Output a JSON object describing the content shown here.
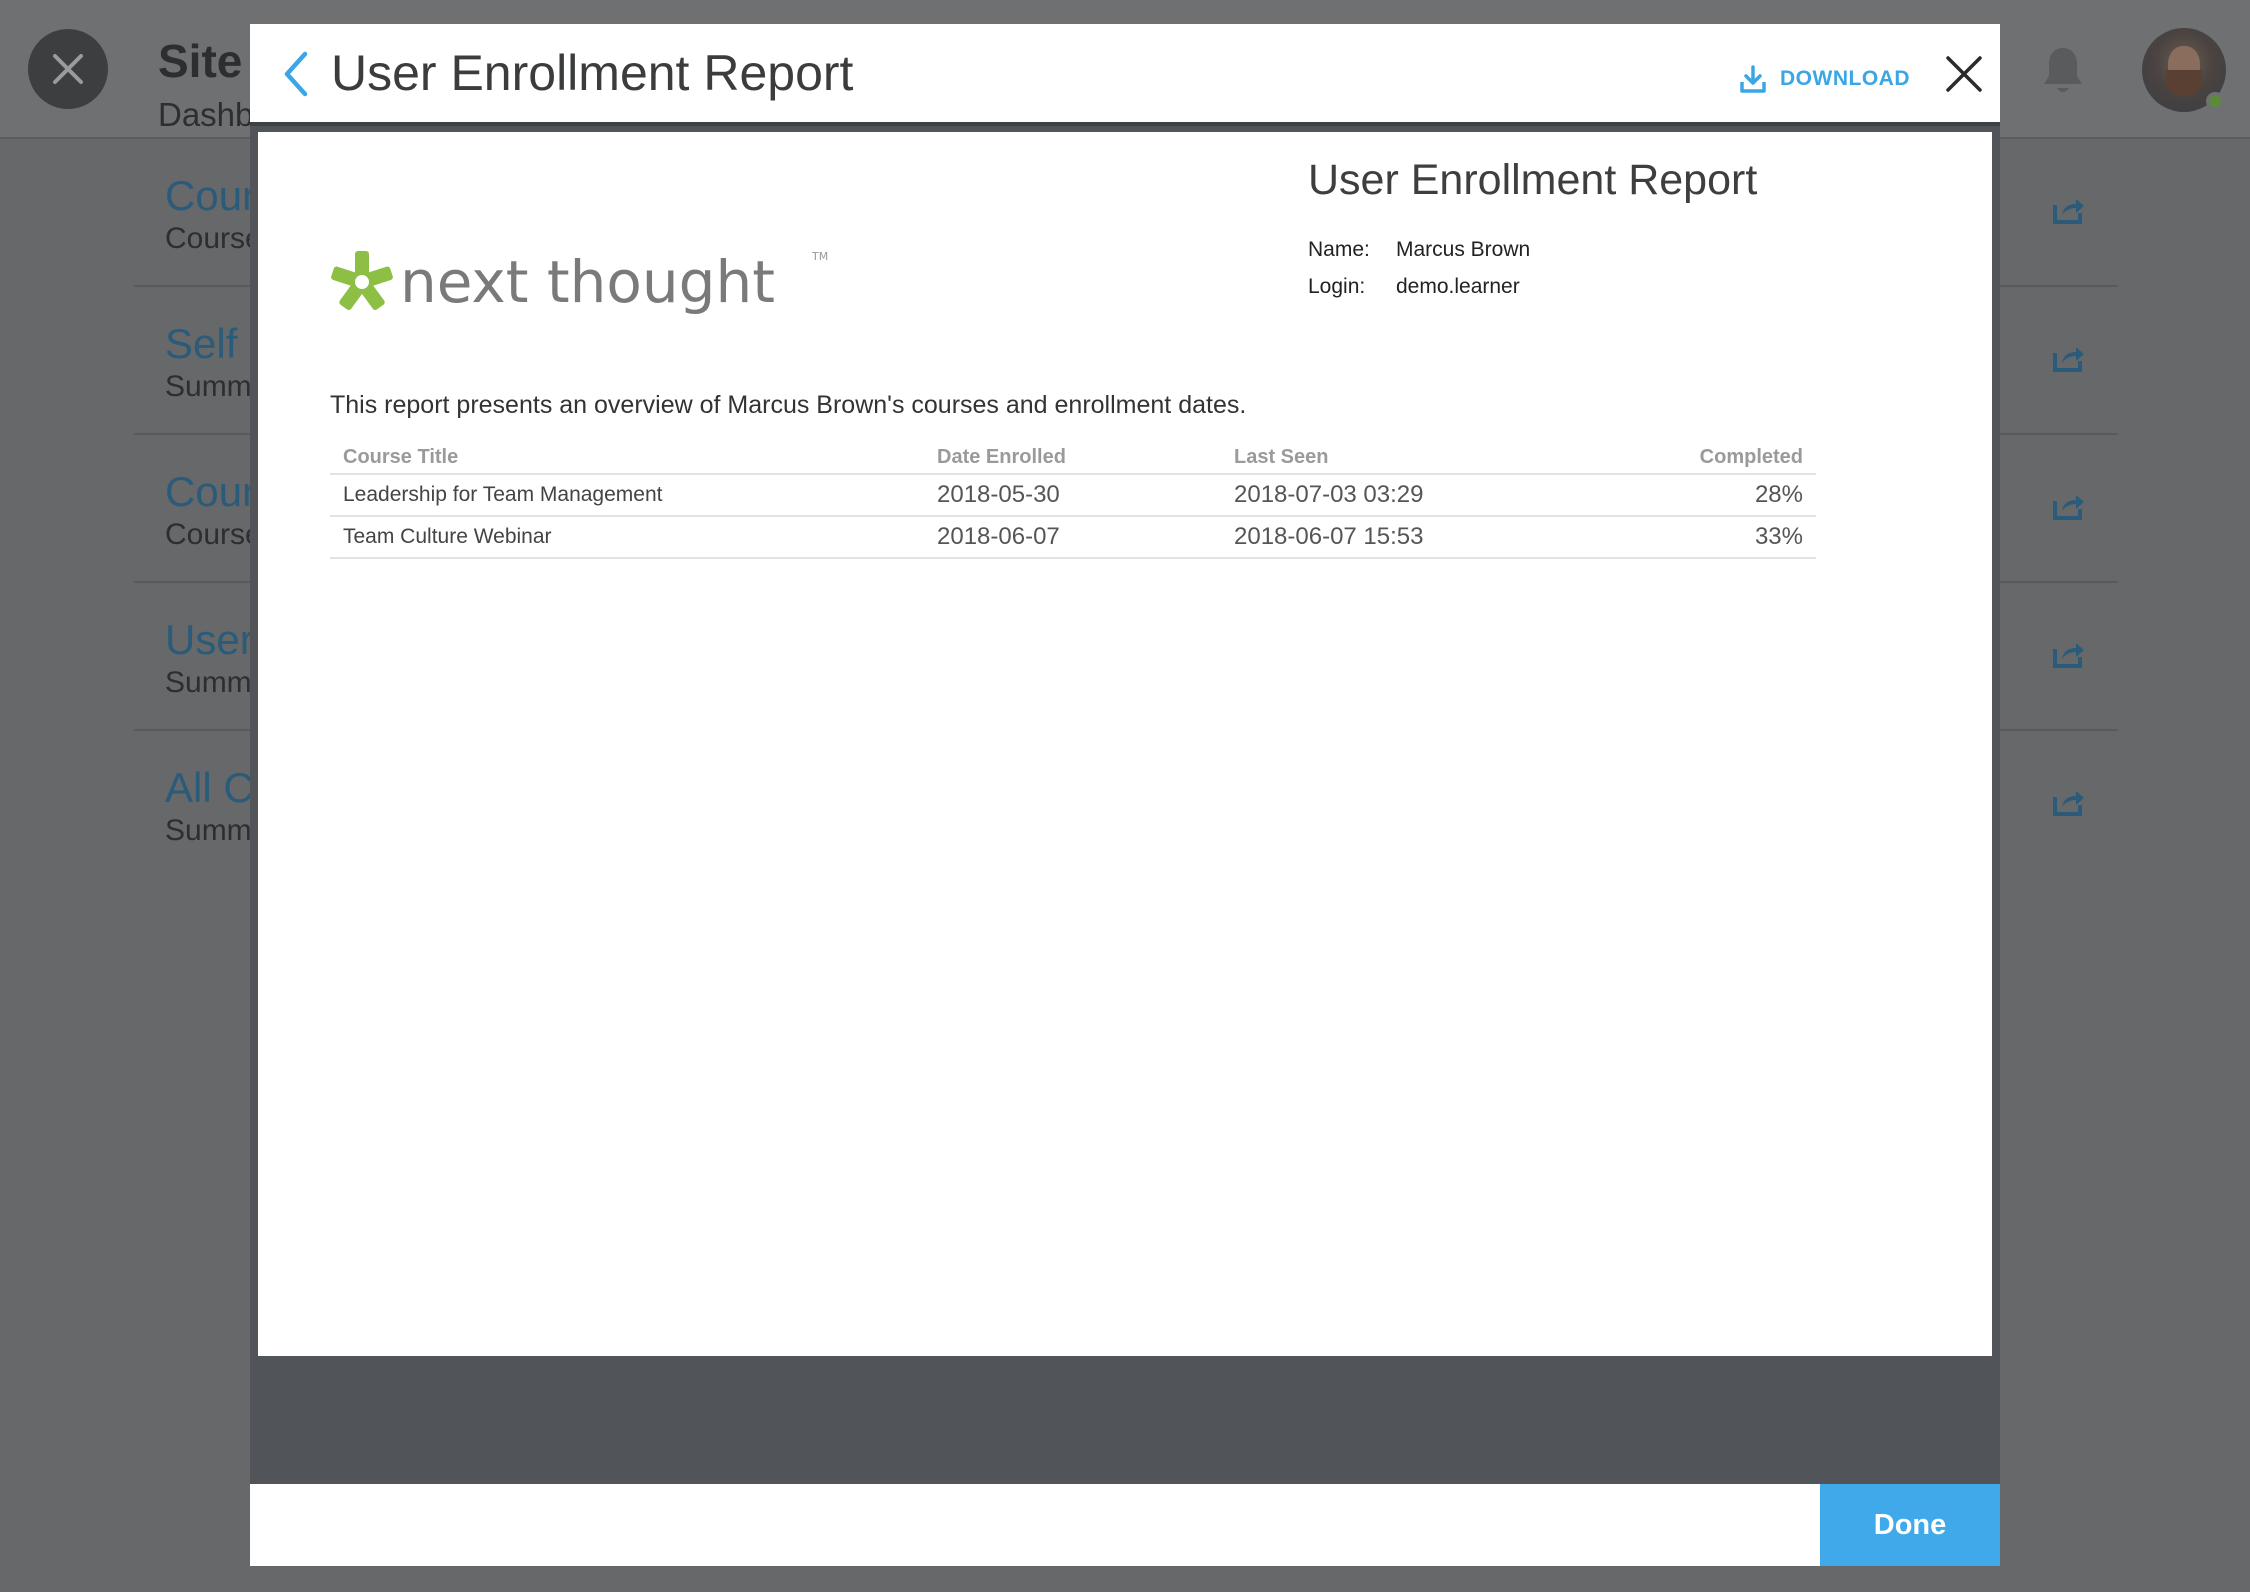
{
  "background": {
    "title": "Site",
    "subtitle": "Dashb",
    "rows": [
      {
        "title": "Cour",
        "subtitle": "Course"
      },
      {
        "title": "Self",
        "subtitle": "Summ"
      },
      {
        "title": "Cour",
        "subtitle": "Course"
      },
      {
        "title": "User",
        "subtitle": "Summ"
      },
      {
        "title": "All C",
        "subtitle": "Summ"
      }
    ]
  },
  "modal": {
    "title": "User Enrollment Report",
    "download_label": "DOWNLOAD",
    "done_label": "Done"
  },
  "report": {
    "logo_text": "next thought",
    "logo_tm": "TM",
    "heading": "User Enrollment Report",
    "name_label": "Name:",
    "name_value": "Marcus Brown",
    "login_label": "Login:",
    "login_value": "demo.learner",
    "intro": "This report presents an overview of Marcus Brown's courses and enrollment dates.",
    "columns": {
      "course_title": "Course Title",
      "date_enrolled": "Date Enrolled",
      "last_seen": "Last Seen",
      "completed": "Completed"
    },
    "rows": [
      {
        "course_title": "Leadership for Team Management",
        "date_enrolled": "2018-05-30",
        "last_seen": "2018-07-03 03:29",
        "completed": "28%"
      },
      {
        "course_title": "Team Culture Webinar",
        "date_enrolled": "2018-06-07",
        "last_seen": "2018-06-07 15:53",
        "completed": "33%"
      }
    ]
  },
  "colors": {
    "accent": "#3fa9ea",
    "logo_green": "#8dbf45",
    "logo_gray": "#7a7a7a",
    "link_dim": "#2b5b7a"
  },
  "icons": {
    "back": "chevron-left-icon",
    "download": "download-icon",
    "close": "close-icon",
    "bell": "bell-icon",
    "export": "export-icon"
  }
}
